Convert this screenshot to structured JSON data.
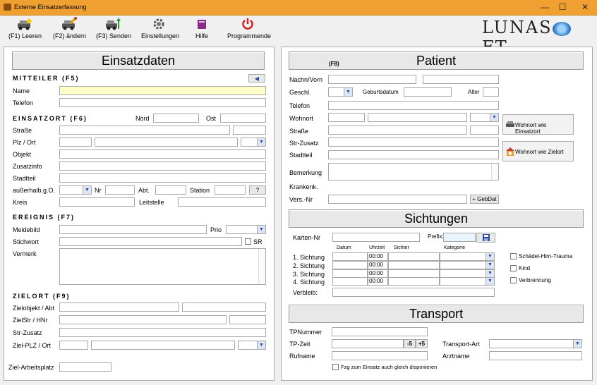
{
  "window": {
    "title": "Externe Einsatzerfassung",
    "min": "—",
    "max": "☐",
    "close": "✕"
  },
  "toolbar": [
    {
      "label": "(F1) Leeren"
    },
    {
      "label": "(F2) ändern"
    },
    {
      "label": "(F3) Senden"
    },
    {
      "label": "Einstellungen"
    },
    {
      "label": "Hilfe"
    },
    {
      "label": "Programmende"
    }
  ],
  "logo": {
    "text_left": "LUNAS",
    "text_right": "FT"
  },
  "left": {
    "header": "Einsatzdaten",
    "mitteiler": {
      "title": "MITTEILER (F5)",
      "back": "◀",
      "name": "Name",
      "telefon": "Telefon"
    },
    "einsatzort": {
      "title": "EINSATZORT (F6)",
      "nord": "Nord",
      "ost": "Ost",
      "strasse": "Straße",
      "plz": "Plz / Ort",
      "objekt": "Objekt",
      "zusatz": "Zusatzinfo",
      "stadtteil": "Stadtteil",
      "ausserhalb": "außerhalb.g.O.",
      "nr": "Nr",
      "abt": "Abt.",
      "station": "Station",
      "help": "?",
      "kreis": "Kreis",
      "leitstelle": "Leitstelle"
    },
    "ereignis": {
      "title": "EREIGNIS (F7)",
      "meldebild": "Meldebild",
      "prio": "Prio",
      "stichwort": "Stichwort",
      "sr": "SR",
      "vermerk": "Vermerk"
    },
    "zielort": {
      "title": "ZIELORT (F9)",
      "zielobjekt": "Zielobjekt / Abt",
      "zielstr": "ZielStr / HNr",
      "strzusatz": "Str-Zusatz",
      "zielplz": "Ziel-PLZ / Ort"
    },
    "arbeitsplatz": "Ziel-Arbeitsplatz"
  },
  "right": {
    "patient": {
      "header": "Patient",
      "f8": "(F8)",
      "name": "Nachn/Vorn",
      "geschl": "Geschl.",
      "geburtsdatum": "Geburtsdatum",
      "alter": "Alter",
      "telefon": "Telefon",
      "wohnort": "Wohnort",
      "strasse": "Straße",
      "strzusatz": "Str-Zusatz",
      "stadtteil": "Stadtteil",
      "bemerkung": "Bemerkung",
      "krankenk": "Krankenk.",
      "versnr": "Vers.-Nr",
      "gebdat": "+ GebDat",
      "btn_einsatzort": "Wohnort wie Einsatzort",
      "btn_zielort": "Wohnort wie Zielort"
    },
    "sichtungen": {
      "header": "Sichtungen",
      "karten": "Karten-Nr",
      "prefix": "Prefix:",
      "columns": [
        "Datum",
        "Uhrzeit",
        "Sichter",
        "Kategorie"
      ],
      "rows": [
        {
          "label": "1. Sichtung",
          "time": "00:00"
        },
        {
          "label": "2. Sichtung",
          "time": "00:00"
        },
        {
          "label": "3. Sichtung",
          "time": "00:00"
        },
        {
          "label": "4. Sichtung",
          "time": "00:00"
        }
      ],
      "verbleib": "Verbleib:",
      "checks": [
        "Schädel-Hirn-Trauma",
        "Kind",
        "Verbrennung"
      ]
    },
    "transport": {
      "header": "Transport",
      "tpnummer": "TPNummer",
      "tpzeit": "TP-Zeit",
      "minus": "-5",
      "plus": "+5",
      "art": "Transport-Art",
      "rufname": "Rufname",
      "arztname": "Arztname",
      "fzg": "Fzg zum Einsatz auch gleich disponieren"
    }
  }
}
